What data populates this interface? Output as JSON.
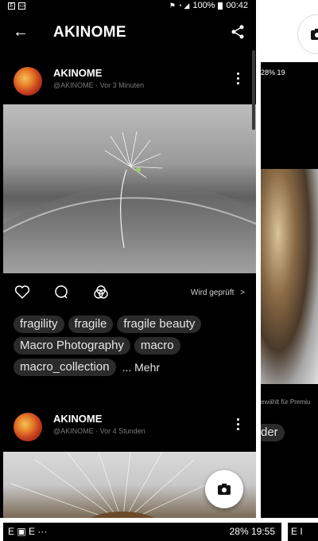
{
  "status": {
    "left_icons": [
      "E",
      "▭"
    ],
    "right_text": "100%",
    "time": "00:42"
  },
  "header": {
    "back_icon": "←",
    "title": "AKINOME",
    "share_icon": "share-icon"
  },
  "posts": [
    {
      "user": "AKINOME",
      "meta": "@AKINOME · Vor 3 Minuten"
    },
    {
      "user": "AKINOME",
      "meta": "@AKINOME · Vor 4 Stunden"
    }
  ],
  "actions": {
    "review_label": "Wird geprüft",
    "review_chevron": ">"
  },
  "tags": [
    "fragility",
    "fragile",
    "fragile beauty",
    "Macro Photography",
    "macro",
    "macro_collection"
  ],
  "more_label": "... Mehr",
  "right_phone": {
    "status": "28% 19",
    "small_text": "ewählt für Premiu",
    "tag": "der"
  },
  "bottom_strip": {
    "left": "E  ▣  E  ···",
    "right": "28% 19:55",
    "far_right": "E I"
  }
}
